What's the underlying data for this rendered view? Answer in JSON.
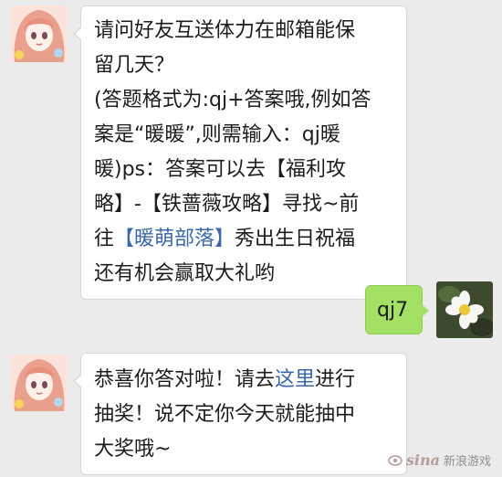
{
  "messages": [
    {
      "side": "left",
      "lines": [
        {
          "parts": [
            {
              "text": "请问好友互送体力在邮箱能保"
            }
          ]
        },
        {
          "parts": [
            {
              "text": "留几天？"
            }
          ]
        },
        {
          "parts": [
            {
              "text": "(答题格式为:qj+答案哦,例如答"
            }
          ]
        },
        {
          "parts": [
            {
              "text": "案是“暖暖”,则需输入：qj暖"
            }
          ]
        },
        {
          "parts": [
            {
              "text": "暖)ps：答案可以去【福利攻"
            }
          ]
        },
        {
          "parts": [
            {
              "text": "略】-【铁蔷薇攻略】寻找~前"
            }
          ]
        },
        {
          "parts": [
            {
              "text": "往"
            },
            {
              "text": "【暖萌部落】",
              "link": true
            },
            {
              "text": "秀出生日祝福"
            }
          ]
        },
        {
          "parts": [
            {
              "text": "还有机会赢取大礼哟"
            }
          ]
        }
      ]
    },
    {
      "side": "right",
      "lines": [
        {
          "parts": [
            {
              "text": "qj7"
            }
          ]
        }
      ]
    },
    {
      "side": "left",
      "lines": [
        {
          "parts": [
            {
              "text": "恭喜你答对啦！请去"
            },
            {
              "text": "这里",
              "link": true
            },
            {
              "text": "进行"
            }
          ]
        },
        {
          "parts": [
            {
              "text": "抽奖！说不定你今天就能抽中"
            }
          ]
        },
        {
          "parts": [
            {
              "text": "大奖哦~"
            }
          ]
        }
      ]
    }
  ],
  "watermark": {
    "brand": "sina",
    "label": "新浪游戏"
  },
  "colors": {
    "background": "#ebebeb",
    "incoming_bubble": "#ffffff",
    "outgoing_bubble": "#a3e164",
    "link": "#3a66a8"
  },
  "icons": {
    "bot_avatar": "anime-girl-avatar",
    "user_avatar": "white-flower-avatar"
  }
}
